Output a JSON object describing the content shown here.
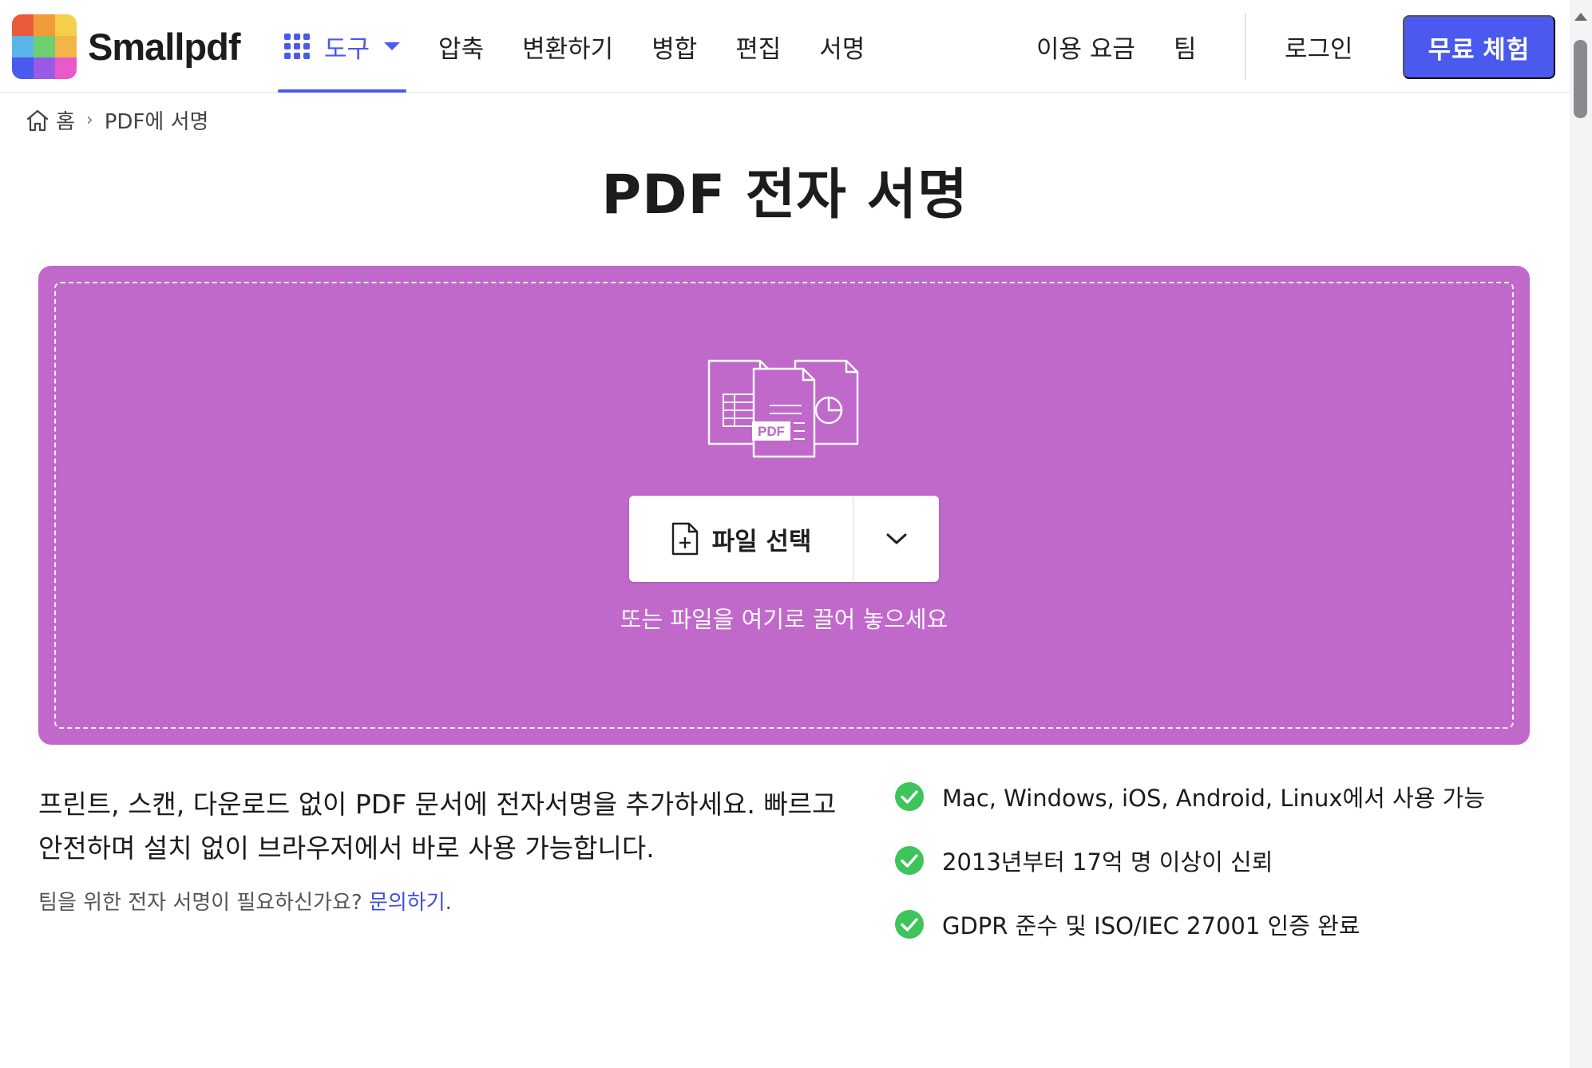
{
  "brand": {
    "name": "Smallpdf"
  },
  "nav": {
    "tools_label": "도구",
    "items": [
      "압축",
      "변환하기",
      "병합",
      "편집",
      "서명"
    ]
  },
  "header_right": {
    "pricing": "이용 요금",
    "team": "팀",
    "login": "로그인",
    "cta": "무료 체험"
  },
  "breadcrumb": {
    "home": "홈",
    "current": "PDF에 서명"
  },
  "page": {
    "title": "PDF 전자 서명"
  },
  "dropzone": {
    "art_label": "PDF",
    "choose_label": "파일 선택",
    "hint": "또는 파일을 여기로 끌어 놓으세요",
    "color": "#c069cb"
  },
  "description": {
    "text": "프린트, 스캔, 다운로드 없이 PDF 문서에 전자서명을 추가하세요. 빠르고 안전하며 설치 없이 브라우저에서 바로 사용 가능합니다.",
    "team_question": "팀을 위한 전자 서명이 필요하신가요?",
    "contact_link": "문의하기",
    "contact_suffix": "."
  },
  "features": [
    "Mac, Windows, iOS, Android, Linux에서 사용 가능",
    "2013년부터 17억 명 이상이 신뢰",
    "GDPR 준수 및 ISO/IEC 27001 인증 완료"
  ],
  "colors": {
    "accent": "#4a59ee",
    "check": "#3fc35b"
  }
}
